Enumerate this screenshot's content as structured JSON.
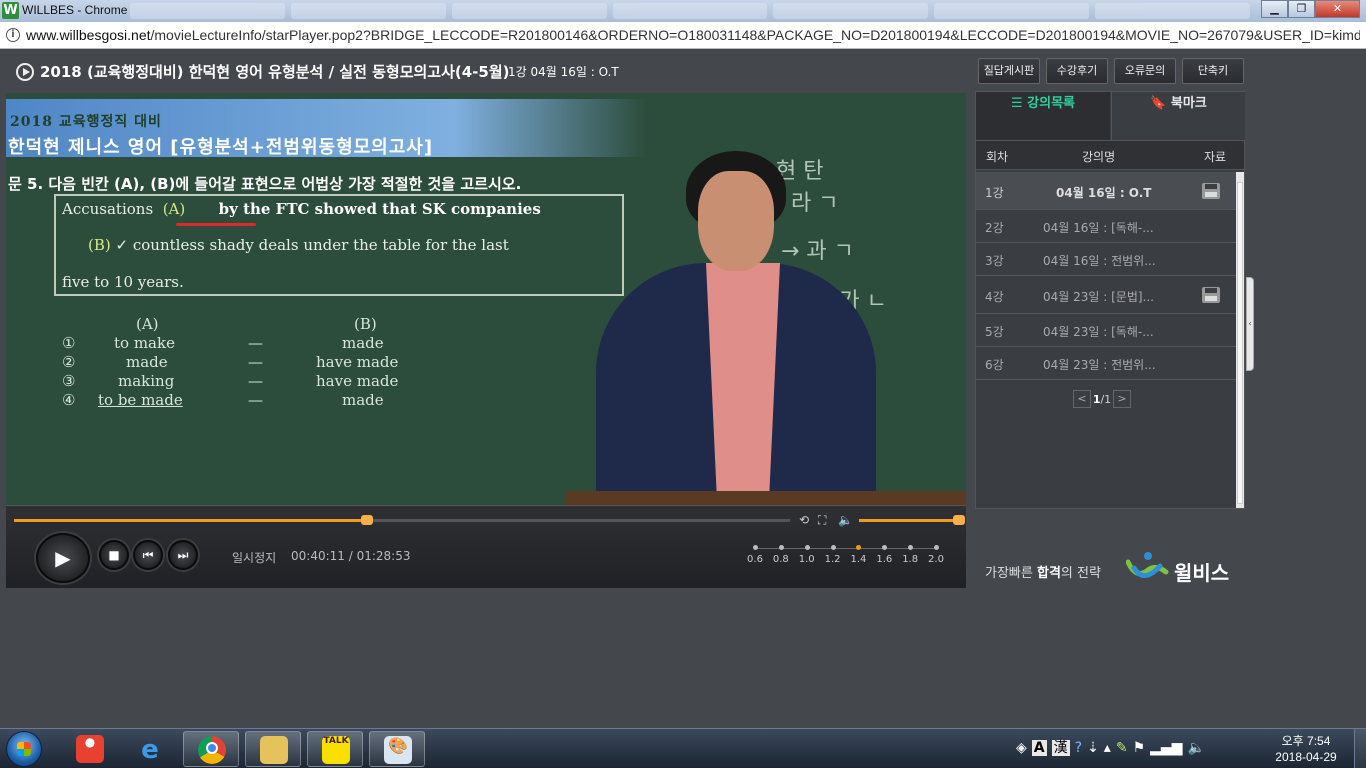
{
  "window": {
    "title": "WILLBES - Chrome",
    "app_icon_letter": "W",
    "minimize": "▁",
    "maximize": "❐",
    "close": "✕"
  },
  "address_bar": {
    "url_host": "www.willbesgosi.net",
    "url_path": "/movieLectureInfo/starPlayer.pop2?BRIDGE_LECCODE=R201800146&ORDERNO=O180031148&PACKAGE_NO=D201800194&LECCODE=D201800194&MOVIE_NO=267079&USER_ID=kimdo..."
  },
  "header": {
    "title": "2018 (교육행정대비) 한덕현 영어 유형분석 / 실전 동형모의고사(4-5월)",
    "subtitle": "1강 04월 16일 : O.T",
    "buttons": [
      "질답게시판",
      "수강후기",
      "오류문의",
      "단축키"
    ]
  },
  "video": {
    "banner_small": "2018 교육행정직 대비",
    "banner_big": "한덕현 제니스 영어 [유형분석+전범위동형모의고사]",
    "question": "문 5. 다음 빈칸 (A), (B)에 들어갈 표현으로 어법상 가장 적절한 것을 고르시오.",
    "line1_a": "Accusations",
    "line1_b": "(A)",
    "line1_c": "by the FTC showed that SK companies",
    "line2_a": "(B)",
    "line2_b": "countless shady deals under the table for the last",
    "line3": "five to 10 years.",
    "col_a": "(A)",
    "col_b": "(B)",
    "options": [
      {
        "num": "①",
        "a": "to make",
        "dash": "—",
        "b": "made"
      },
      {
        "num": "②",
        "a": "made",
        "dash": "—",
        "b": "have made"
      },
      {
        "num": "③",
        "a": "making",
        "dash": "—",
        "b": "have made"
      },
      {
        "num": "④",
        "a": "to be made",
        "dash": "—",
        "b": "made"
      }
    ],
    "chalk_notes": [
      "현 탄",
      "라 ㄱ",
      "→ 과 ㄱ",
      "+ 가 ㄴ"
    ]
  },
  "player": {
    "status": "일시정지",
    "current_time": "00:40:11",
    "total_time": "/ 01:28:53",
    "progress": 0.455,
    "volume": 1.0,
    "speeds": [
      "0.6",
      "0.8",
      "1.0",
      "1.2",
      "1.4",
      "1.6",
      "1.8",
      "2.0"
    ],
    "active_speed": "1.4",
    "icons": {
      "play": "▶",
      "stop": "■",
      "prev": "⏮",
      "next": "⏭",
      "repeat": "⟲",
      "fullscreen": "⛶",
      "volume": "🔈"
    }
  },
  "sidebar": {
    "tabs": [
      {
        "icon": "☰",
        "label": "강의목록",
        "active": true
      },
      {
        "icon": "🔖",
        "label": "북마크",
        "active": false
      }
    ],
    "columns": [
      "회차",
      "강의명",
      "자료"
    ],
    "lectures": [
      {
        "no": "1강",
        "name": "04월 16일 : O.T",
        "has_file": true
      },
      {
        "no": "2강",
        "name": "04월 16일 : [독해-...",
        "has_file": false
      },
      {
        "no": "3강",
        "name": "04월 16일 : 전범위...",
        "has_file": false
      },
      {
        "no": "4강",
        "name": "04월 23일 : [문법]...",
        "has_file": true
      },
      {
        "no": "5강",
        "name": "04월 23일 : [독해-...",
        "has_file": false
      },
      {
        "no": "6강",
        "name": "04월 23일 : 전범위...",
        "has_file": false
      }
    ],
    "pager": {
      "prev": "<",
      "current": "1",
      "total": "/1",
      "next": ">"
    }
  },
  "brand": {
    "slogan_pre": "가장빠른 ",
    "slogan_bold": "합격",
    "slogan_post": "의 전략",
    "name": "윌비스"
  },
  "taskbar": {
    "apps": [
      "start",
      "talk-recorder",
      "internet-explorer",
      "chrome",
      "file-explorer",
      "kakaotalk",
      "paint"
    ],
    "kakao_label": "TALK",
    "ime_a": "A",
    "ime_han": "漢",
    "help": "?",
    "clock_time": "오후 7:54",
    "clock_date": "2018-04-29"
  },
  "colors": {
    "accent": "#f29a1d",
    "tab_active": "#2fd19a",
    "board": "#2d4d3c"
  }
}
